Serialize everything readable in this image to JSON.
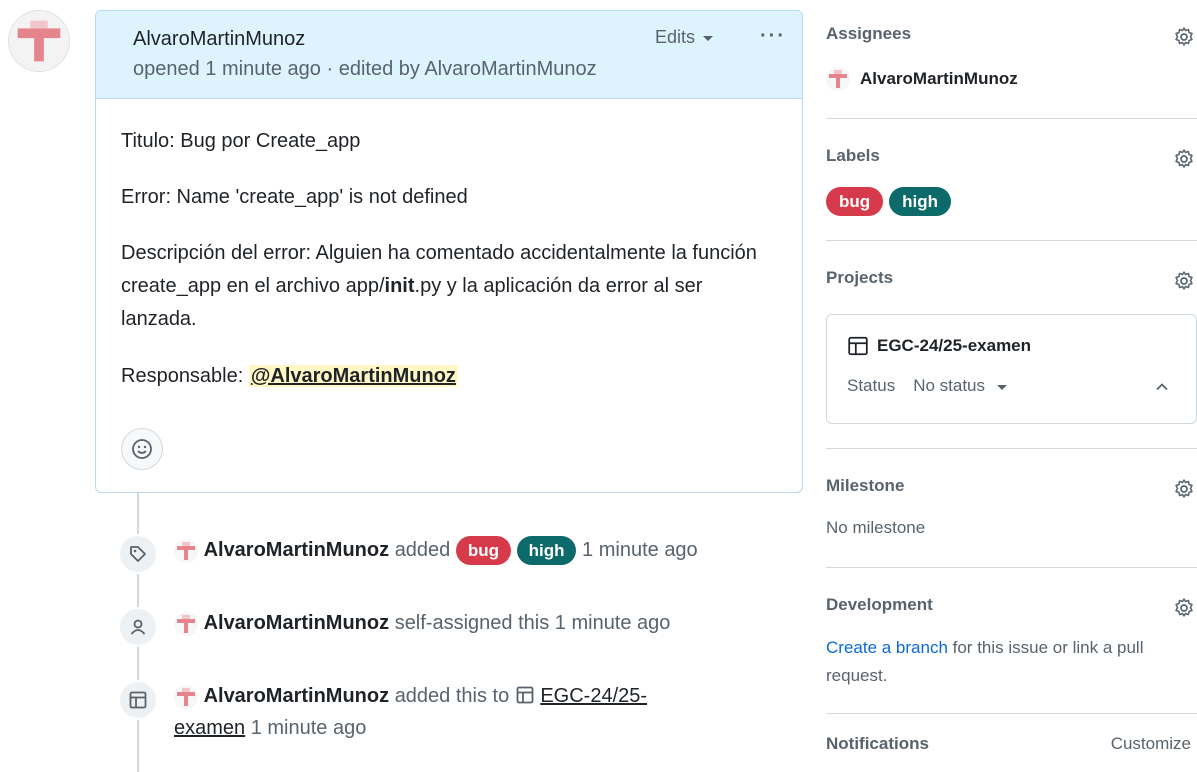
{
  "comment": {
    "author": "AlvaroMartinMunoz",
    "subline": "opened 1 minute ago · edited by AlvaroMartinMunoz",
    "edits_label": "Edits",
    "kebab": "···",
    "body": {
      "line1": "Titulo: Bug por Create_app",
      "line2": "Error: Name 'create_app' is not defined",
      "desc_pre": "Descripción del error: Alguien ha comentado accidentalmente la función create_app en el archivo app/",
      "desc_bold": "init",
      "desc_post": ".py y la aplicación da error al ser lanzada.",
      "resp_label": "Responsable:",
      "resp_mention": "@AlvaroMartinMunoz"
    }
  },
  "timeline": [
    {
      "actor": "AlvaroMartinMunoz",
      "action": "added",
      "labels": [
        "bug",
        "high"
      ],
      "time": "1 minute ago"
    },
    {
      "actor": "AlvaroMartinMunoz",
      "action": "self-assigned this",
      "time": "1 minute ago"
    },
    {
      "actor": "AlvaroMartinMunoz",
      "action": "added this to",
      "project": "EGC-24/25-examen",
      "time": "1 minute ago"
    }
  ],
  "sidebar": {
    "assignees": {
      "title": "Assignees",
      "user": "AlvaroMartinMunoz"
    },
    "labels": {
      "title": "Labels",
      "items": [
        "bug",
        "high"
      ]
    },
    "projects": {
      "title": "Projects",
      "name": "EGC-24/25-examen",
      "status_label": "Status",
      "status_value": "No status"
    },
    "milestone": {
      "title": "Milestone",
      "value": "No milestone"
    },
    "development": {
      "title": "Development",
      "link": "Create a branch",
      "text": " for this issue or link a pull request."
    },
    "notifications": {
      "title": "Notifications",
      "action": "Customize"
    }
  },
  "colors": {
    "label_bug": "#d73a4a",
    "label_high": "#0c6a6a",
    "header_bg": "#ddf4ff",
    "link": "#0969da"
  }
}
